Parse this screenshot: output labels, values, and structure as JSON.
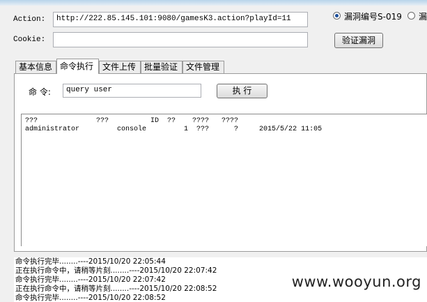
{
  "form": {
    "action_label": "Action:",
    "action_value": "http://222.85.145.101:9080/gamesK3.action?playId=11",
    "cookie_label": "Cookie:",
    "cookie_value": "",
    "verify_button": "验证漏洞"
  },
  "vuln_options": [
    {
      "label": "漏洞编号S-019",
      "selected": true
    },
    {
      "label": "漏",
      "selected": false
    }
  ],
  "tabs": [
    "基本信息",
    "命令执行",
    "文件上传",
    "批量验证",
    "文件管理"
  ],
  "active_tab": "命令执行",
  "command": {
    "label": "命 令:",
    "value": "query user",
    "execute_button": "执 行"
  },
  "result": {
    "header": "???              ???          ID  ??    ????   ????",
    "rows": [
      "administrator         console         1  ???      ?     2015/5/22 11:05"
    ]
  },
  "log": [
    "命令执行完毕........----2015/10/20 22:05:44",
    "正在执行命令中，请稍等片刻........----2015/10/20 22:07:42",
    "命令执行完毕........----2015/10/20 22:07:42",
    "正在执行命令中，请稍等片刻........----2015/10/20 22:08:52",
    "命令执行完毕........----2015/10/20 22:08:52"
  ],
  "watermark": "www.wooyun.org"
}
